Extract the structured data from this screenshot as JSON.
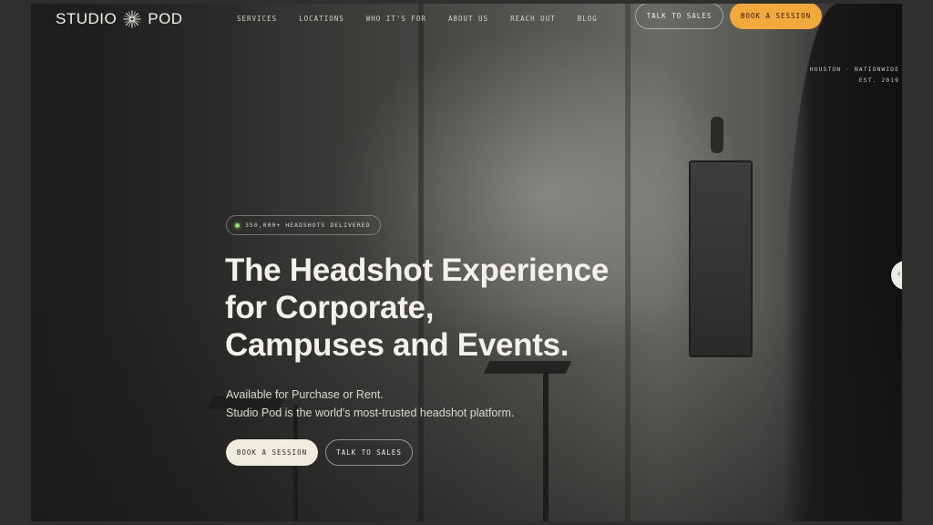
{
  "brand": {
    "name_left": "STUDIO",
    "name_right": "POD",
    "logo_icon": "starburst-icon"
  },
  "nav": {
    "items": [
      {
        "label": "SERVICES"
      },
      {
        "label": "LOCATIONS"
      },
      {
        "label": "WHO IT'S FOR"
      },
      {
        "label": "ABOUT US"
      },
      {
        "label": "REACH OUT"
      },
      {
        "label": "BLOG"
      }
    ],
    "talk_to_sales": "TALK TO SALES",
    "book_session": "BOOK A SESSION"
  },
  "location": {
    "line1": "HOUSTON · NATIONWIDE",
    "line2": "EST. 2019"
  },
  "hero": {
    "badge": "350,000+ HEADSHOTS DELIVERED",
    "headline": [
      "The Headshot Experience",
      "for Corporate,",
      "Campuses and Events."
    ],
    "subtext": [
      "Available for Purchase or Rent.",
      "Studio Pod is the world's most-trusted headshot platform."
    ],
    "cta_primary": "BOOK A SESSION",
    "cta_secondary": "TALK TO SALES"
  },
  "colors": {
    "accent": "#f2a93b",
    "light_button": "#f1ece2",
    "badge_dot": "#8be36b"
  }
}
